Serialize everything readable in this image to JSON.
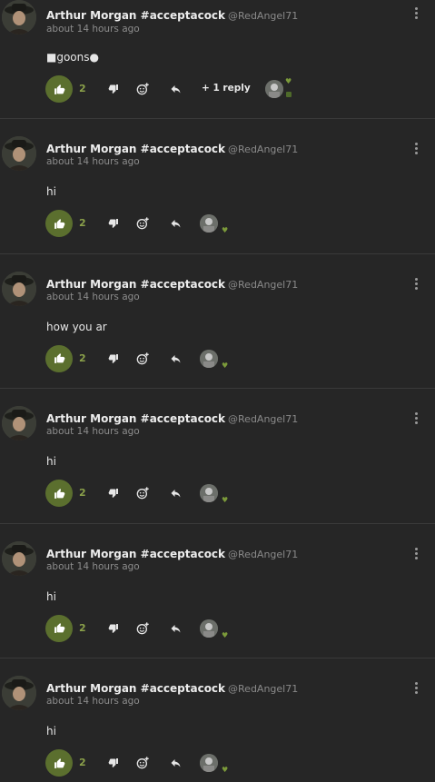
{
  "comments": [
    {
      "author": "Arthur Morgan #acceptacock",
      "handle": "@RedAngel71",
      "time": "about 14 hours ago",
      "text": "■goons●",
      "likes": "2",
      "replies": "+ 1 reply"
    },
    {
      "author": "Arthur Morgan #acceptacock",
      "handle": "@RedAngel71",
      "time": "about 14 hours ago",
      "text": "hi",
      "likes": "2"
    },
    {
      "author": "Arthur Morgan #acceptacock",
      "handle": "@RedAngel71",
      "time": "about 14 hours ago",
      "text": "how you ar",
      "likes": "2"
    },
    {
      "author": "Arthur Morgan #acceptacock",
      "handle": "@RedAngel71",
      "time": "about 14 hours ago",
      "text": "hi",
      "likes": "2"
    },
    {
      "author": "Arthur Morgan #acceptacock",
      "handle": "@RedAngel71",
      "time": "about 14 hours ago",
      "text": "hi",
      "likes": "2"
    },
    {
      "author": "Arthur Morgan #acceptacock",
      "handle": "@RedAngel71",
      "time": "about 14 hours ago",
      "text": "hi",
      "likes": "2"
    }
  ],
  "icons": {
    "like": "thumbs-up-icon",
    "dislike": "thumbs-down-icon",
    "react": "add-emoji-icon",
    "reply": "reply-arrow-icon",
    "menu": "kebab-menu-icon"
  },
  "colors": {
    "background": "#262626",
    "like_active": "#5b6f2e",
    "like_count": "#8aa04a"
  }
}
